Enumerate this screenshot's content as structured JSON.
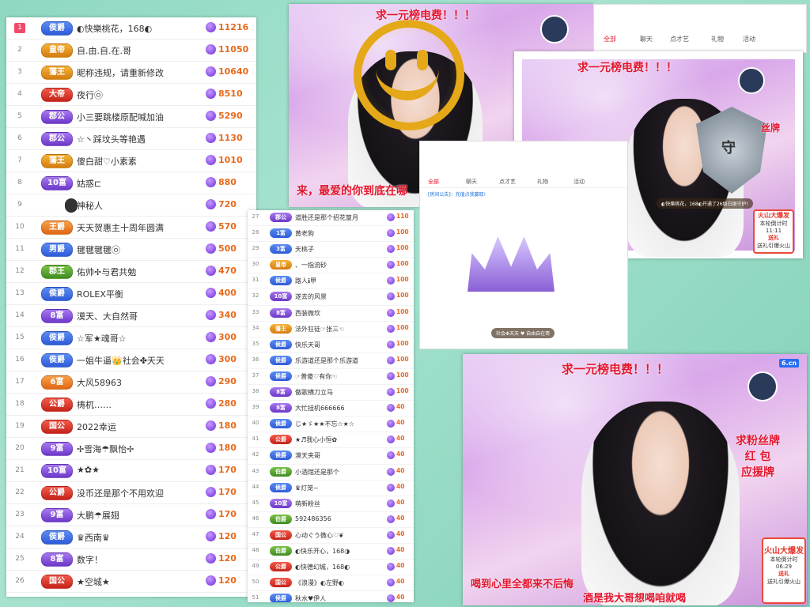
{
  "main_rank": [
    {
      "num": "1",
      "badge": "侯爵",
      "color": "blue",
      "name": "◐快樂桃花，168◐",
      "value": "11216"
    },
    {
      "num": "2",
      "badge": "皇帝",
      "color": "gold",
      "name": "自.由.自.在.哥",
      "value": "11050"
    },
    {
      "num": "3",
      "badge": "藩王",
      "color": "gold",
      "name": "昵称违规，请重新修改",
      "value": "10640"
    },
    {
      "num": "4",
      "badge": "大帝",
      "color": "red",
      "name": "夜行㉧",
      "value": "8510"
    },
    {
      "num": "5",
      "badge": "郡公",
      "color": "purple",
      "name": "小三要跳楼原配喊加油",
      "value": "5290"
    },
    {
      "num": "6",
      "badge": "郡公",
      "color": "purple",
      "name": "☆丶踩坟头等艳遇",
      "value": "1130"
    },
    {
      "num": "7",
      "badge": "藩王",
      "color": "gold",
      "name": "傻白甜♡小素素",
      "value": "1010"
    },
    {
      "num": "8",
      "badge": "10富",
      "color": "purple",
      "name": "姑惑⊏",
      "value": "880"
    },
    {
      "num": "9",
      "badge": "",
      "color": "dark",
      "name": "神秘人",
      "value": "720"
    },
    {
      "num": "10",
      "badge": "王爵",
      "color": "orange",
      "name": "天天贺惠主十周年圆满",
      "value": "570"
    },
    {
      "num": "11",
      "badge": "男爵",
      "color": "blue",
      "name": "毽毽毽毽㉧",
      "value": "500"
    },
    {
      "num": "12",
      "badge": "郡王",
      "color": "green",
      "name": "佑帅✢与君共勉",
      "value": "470"
    },
    {
      "num": "13",
      "badge": "侯爵",
      "color": "blue",
      "name": "ROLEX平衡",
      "value": "400"
    },
    {
      "num": "14",
      "badge": "8富",
      "color": "purple",
      "name": "漠天、大自然哥",
      "value": "340"
    },
    {
      "num": "15",
      "badge": "侯爵",
      "color": "blue",
      "name": "☆军★魂哥☆",
      "value": "300"
    },
    {
      "num": "16",
      "badge": "侯爵",
      "color": "blue",
      "name": "一姐牛逼👑社会✤天天",
      "value": "300"
    },
    {
      "num": "17",
      "badge": "6富",
      "color": "orange",
      "name": "大风58963",
      "value": "290"
    },
    {
      "num": "18",
      "badge": "公爵",
      "color": "red",
      "name": "梼杌……",
      "value": "280"
    },
    {
      "num": "19",
      "badge": "国公",
      "color": "red",
      "name": "2022幸运",
      "value": "180"
    },
    {
      "num": "20",
      "badge": "9富",
      "color": "purple",
      "name": "✢雪海☂飘怡✢",
      "value": "180"
    },
    {
      "num": "21",
      "badge": "10富",
      "color": "purple",
      "name": "★✿★",
      "value": "170"
    },
    {
      "num": "22",
      "badge": "公爵",
      "color": "red",
      "name": "没币还是那个不用欢迎",
      "value": "170"
    },
    {
      "num": "23",
      "badge": "9富",
      "color": "purple",
      "name": "大鹏☂展翅",
      "value": "170"
    },
    {
      "num": "24",
      "badge": "侯爵",
      "color": "blue",
      "name": "♛西南♛",
      "value": "120"
    },
    {
      "num": "25",
      "badge": "8富",
      "color": "purple",
      "name": "数字！",
      "value": "120"
    },
    {
      "num": "26",
      "badge": "国公",
      "color": "red",
      "name": "★空城★",
      "value": "120"
    }
  ],
  "second_rank": [
    {
      "num": "27",
      "badge": "郡公",
      "color": "purple",
      "name": "道胜还是那个招花篁月",
      "value": "110"
    },
    {
      "num": "28",
      "badge": "1富",
      "color": "blue",
      "name": "黄老狗",
      "value": "100"
    },
    {
      "num": "29",
      "badge": "3富",
      "color": "blue",
      "name": "天桃子",
      "value": "100"
    },
    {
      "num": "30",
      "badge": "皇帝",
      "color": "gold",
      "name": "、一指流砂",
      "value": "100"
    },
    {
      "num": "31",
      "badge": "侯爵",
      "color": "blue",
      "name": "路人ℹ甲",
      "value": "100"
    },
    {
      "num": "32",
      "badge": "10富",
      "color": "purple",
      "name": "遂去的风景",
      "value": "100"
    },
    {
      "num": "33",
      "badge": "8富",
      "color": "purple",
      "name": "西装微坎",
      "value": "100"
    },
    {
      "num": "34",
      "badge": "藩王",
      "color": "gold",
      "name": "法外狂徒☞张三☜",
      "value": "100"
    },
    {
      "num": "35",
      "badge": "侯爵",
      "color": "blue",
      "name": "快乐天哥",
      "value": "100"
    },
    {
      "num": "36",
      "badge": "侯爵",
      "color": "blue",
      "name": "乐游道还是那个乐游道",
      "value": "100"
    },
    {
      "num": "37",
      "badge": "侯爵",
      "color": "blue",
      "name": "☞普傻♡有你☜",
      "value": "100"
    },
    {
      "num": "38",
      "badge": "8富",
      "color": "purple",
      "name": "傲歌横刀立马",
      "value": "100"
    },
    {
      "num": "39",
      "badge": "8富",
      "color": "purple",
      "name": "大忙挂机666666",
      "value": "40"
    },
    {
      "num": "40",
      "badge": "侯爵",
      "color": "blue",
      "name": "じ★ゞ★★不忘☆★☆",
      "value": "40"
    },
    {
      "num": "41",
      "badge": "公爵",
      "color": "red",
      "name": "★♬我心小恒✿",
      "value": "40"
    },
    {
      "num": "42",
      "badge": "侯爵",
      "color": "blue",
      "name": "漠天夹哥",
      "value": "40"
    },
    {
      "num": "43",
      "badge": "伯爵",
      "color": "green",
      "name": "小酒馆还是那个",
      "value": "40"
    },
    {
      "num": "44",
      "badge": "侯爵",
      "color": "blue",
      "name": "♛灯笼~",
      "value": "40"
    },
    {
      "num": "45",
      "badge": "10富",
      "color": "purple",
      "name": "萌新粉丝",
      "value": "40"
    },
    {
      "num": "46",
      "badge": "伯爵",
      "color": "green",
      "name": "592486356",
      "value": "40"
    },
    {
      "num": "47",
      "badge": "国公",
      "color": "red",
      "name": "心动ぐう微心♡❦",
      "value": "40"
    },
    {
      "num": "48",
      "badge": "伯爵",
      "color": "green",
      "name": "◐快乐开心，168◑",
      "value": "40"
    },
    {
      "num": "49",
      "badge": "公爵",
      "color": "red",
      "name": "◐快德幻城，168◐",
      "value": "40"
    },
    {
      "num": "50",
      "badge": "国公",
      "color": "red",
      "name": "《浪漫》◐左野◐",
      "value": "40"
    },
    {
      "num": "51",
      "badge": "侯爵",
      "color": "blue",
      "name": "秋水♥伊人",
      "value": "40"
    }
  ],
  "streams": {
    "banner_1": "求一元榜电费！！！",
    "banner_2": "求一元榜电费！！！",
    "banner_3": "求一元榜电费！！！",
    "sub_text_1": "来，最爱的你到底在哪",
    "side_text_3": [
      "求粉丝牌",
      "红  包",
      "应援牌"
    ],
    "bottom_text_3a": "喝到心里全都来不后悔",
    "bottom_text_3b": "酒是我大哥想喝咱就喝",
    "guard_msg": "◐快樂桃花，168◐开通了26级白银守护!",
    "crown_msg": "社会✤天天 ♥ 自由自在哥",
    "promo_title": "火山大爆发",
    "promo_time_label": "本轮倒计时",
    "promo_time_1": "11:11",
    "promo_time_3": "06:29",
    "promo_btn": "送礼",
    "promo_footer": "送礼引爆火山",
    "logo": "6.cn",
    "tab_all": "全部",
    "tab_chat": "聊天",
    "tab_talent": "点才艺",
    "tab_gift": "礼物",
    "tab_event": "活动",
    "chat_notice": "[房间公告]：充值点我赢取!",
    "guard_char": "守",
    "sign_fan": "丝牌"
  }
}
